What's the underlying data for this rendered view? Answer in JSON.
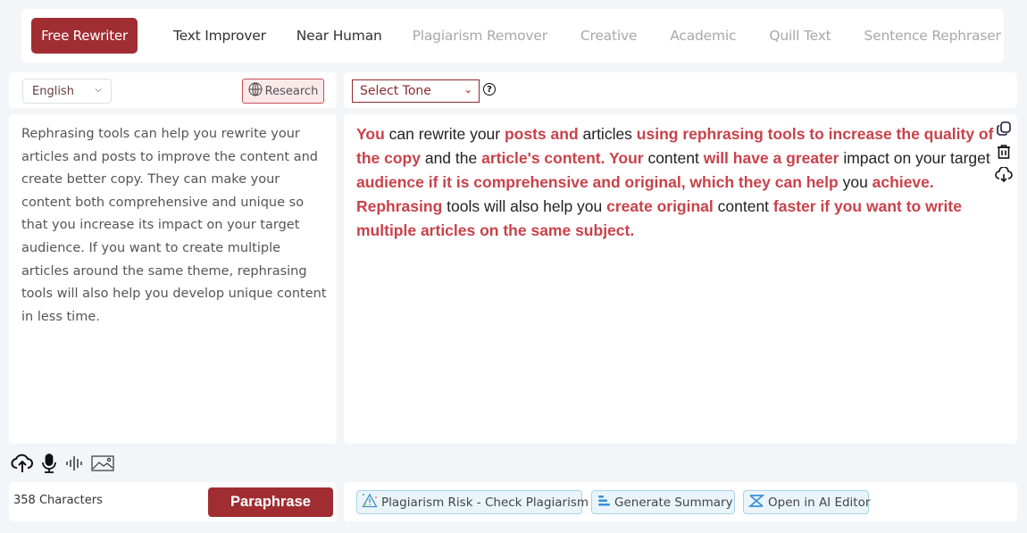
{
  "nav": {
    "tabs": [
      {
        "label": "Free Rewriter",
        "state": "active"
      },
      {
        "label": "Text Improver",
        "state": "enabled"
      },
      {
        "label": "Near Human",
        "state": "enabled"
      },
      {
        "label": "Plagiarism Remover",
        "state": "muted"
      },
      {
        "label": "Creative",
        "state": "muted"
      },
      {
        "label": "Academic",
        "state": "muted"
      },
      {
        "label": "Quill Text",
        "state": "muted"
      },
      {
        "label": "Sentence Rephraser",
        "state": "muted"
      }
    ]
  },
  "left_toolbar": {
    "language": "English",
    "research_label": "Research"
  },
  "right_toolbar": {
    "tone_placeholder": "Select Tone",
    "help_glyph": "?"
  },
  "input": {
    "text": "Rephrasing tools can help you rewrite your articles and posts to improve the content and create better copy. They can make your content both comprehensive and unique so that you increase its impact on your target audience. If you want to create multiple articles around the same theme, rephrasing tools will also help you develop unique content in less time.",
    "char_count": "358 Characters",
    "paraphrase_label": "Paraphrase",
    "icons": [
      "upload-cloud-icon",
      "microphone-icon",
      "audio-wave-icon",
      "image-icon"
    ]
  },
  "output": {
    "segments": [
      {
        "text": "You",
        "changed": true
      },
      {
        "text": " can rewrite your ",
        "changed": false
      },
      {
        "text": "posts and",
        "changed": true
      },
      {
        "text": " articles ",
        "changed": false
      },
      {
        "text": "using rephrasing tools to increase the quality of the copy",
        "changed": true
      },
      {
        "text": " and the ",
        "changed": false
      },
      {
        "text": "article's content. Your",
        "changed": true
      },
      {
        "text": " content ",
        "changed": false
      },
      {
        "text": "will have a greater",
        "changed": true
      },
      {
        "text": " impact on your target ",
        "changed": false
      },
      {
        "text": "audience if it is comprehensive and original, which they can help",
        "changed": true
      },
      {
        "text": " you ",
        "changed": false
      },
      {
        "text": "achieve. Rephrasing",
        "changed": true
      },
      {
        "text": " tools will also help you ",
        "changed": false
      },
      {
        "text": "create original",
        "changed": true
      },
      {
        "text": " content ",
        "changed": false
      },
      {
        "text": "faster if you want to write multiple articles on the same subject.",
        "changed": true
      }
    ],
    "side_icons": [
      "copy-icon",
      "trash-icon",
      "download-cloud-icon"
    ],
    "highlight_color": "#c8424a"
  },
  "footer_actions": {
    "plagiarism_label": "Plagiarism Risk - Check Plagiarism",
    "summary_label": "Generate Summary",
    "ai_editor_label": "Open in AI Editor"
  },
  "colors": {
    "brand": "#a02d32",
    "background": "#f2f6f9",
    "action_border": "#a9d2e8"
  }
}
